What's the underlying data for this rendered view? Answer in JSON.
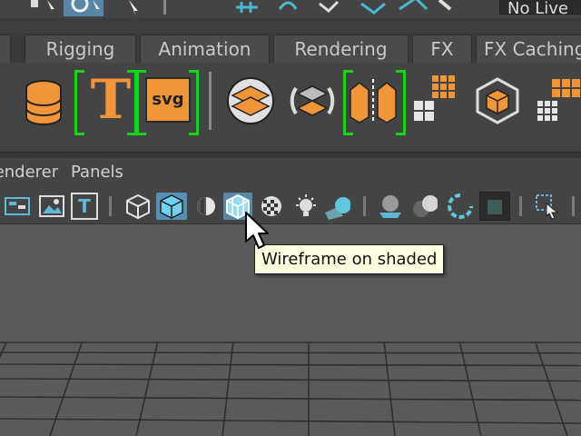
{
  "status_line": {
    "live_field_text": "No Live"
  },
  "shelf": {
    "tabs": [
      "Rigging",
      "Animation",
      "Rendering",
      "FX",
      "FX Caching"
    ],
    "icons": {
      "text_letter": "T",
      "svg_label": "svg"
    }
  },
  "panel_menu": {
    "items": [
      "Renderer",
      "Panels"
    ]
  },
  "panel_toolbar": {
    "text_icon_letter": "T"
  },
  "tooltip": {
    "text": "Wireframe on shaded"
  },
  "colors": {
    "shelf_orange": "#f0953a",
    "highlight_green": "#19d219",
    "active_blue": "#5590b5",
    "tooltip_bg": "#ffffe1"
  }
}
